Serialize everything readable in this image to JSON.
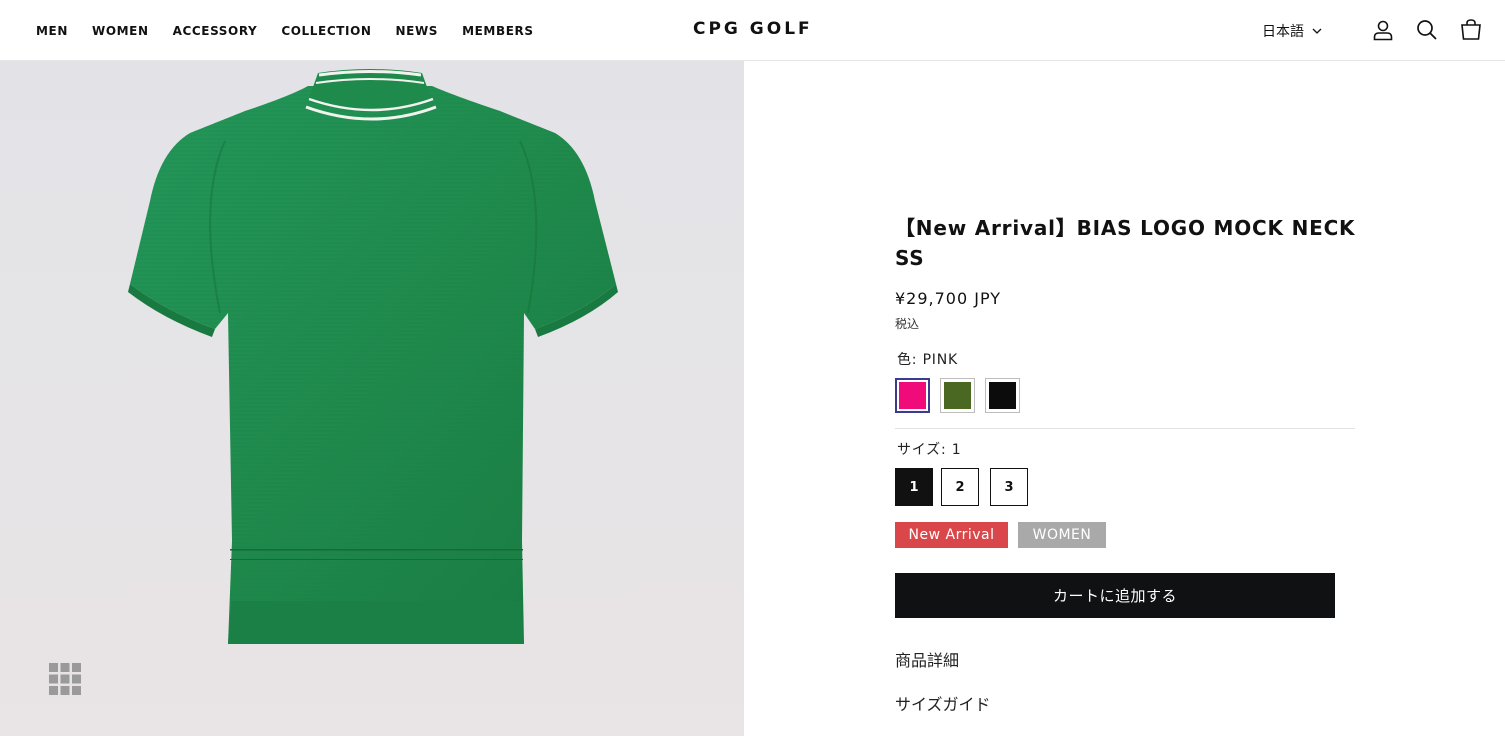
{
  "header": {
    "nav": [
      "MEN",
      "WOMEN",
      "ACCESSORY",
      "COLLECTION",
      "NEWS",
      "MEMBERS"
    ],
    "logo": "CPG GOLF",
    "language": "日本語",
    "icons": [
      "account-icon",
      "search-icon",
      "cart-icon"
    ]
  },
  "product": {
    "image_alt_icon": "grid-icon",
    "title": "【New Arrival】BIAS LOGO MOCK NECK SS",
    "price": "¥29,700 JPY",
    "tax_note": "税込",
    "color_label": "色: PINK",
    "colors": [
      {
        "name": "PINK",
        "hex": "#f00a7a",
        "selected": true
      },
      {
        "name": "OLIVE",
        "hex": "#4b6822",
        "selected": false
      },
      {
        "name": "BLACK",
        "hex": "#0c0c0c",
        "selected": false
      }
    ],
    "size_label": "サイズ: 1",
    "sizes": [
      "1",
      "2",
      "3"
    ],
    "selected_size": "1",
    "tags": [
      "New Arrival",
      "WOMEN"
    ],
    "add_to_cart": "カートに追加する",
    "links": [
      "商品詳細",
      "サイズガイド"
    ]
  },
  "colors": {
    "shirt": "#1f8a4c",
    "tag_new": "#d9474b",
    "tag_women": "#a9a9a9",
    "button_bg": "#0f1113"
  }
}
